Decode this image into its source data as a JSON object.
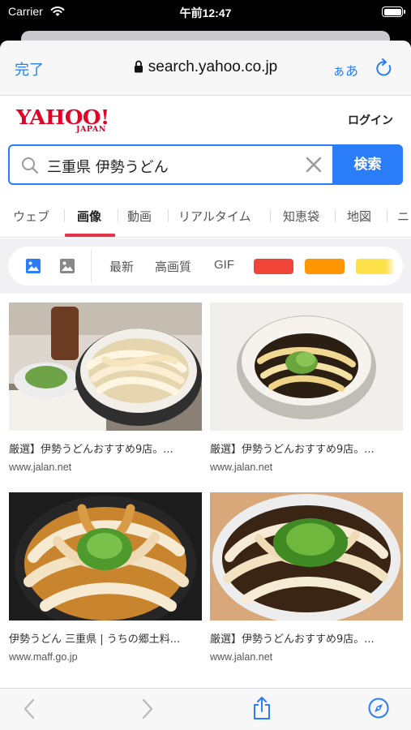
{
  "status_bar": {
    "carrier": "Carrier",
    "time": "午前12:47"
  },
  "nav": {
    "done": "完了",
    "address": "search.yahoo.co.jp",
    "reader": "ぁあ"
  },
  "yahoo": {
    "logo_word": "YAHOO!",
    "logo_sub": "JAPAN",
    "login": "ログイン"
  },
  "search": {
    "query": "三重県 伊勢うどん",
    "button": "検索"
  },
  "tabs": [
    "ウェブ",
    "画像",
    "動画",
    "リアルタイム",
    "知恵袋",
    "地図",
    "ニ"
  ],
  "active_tab": "画像",
  "filters": {
    "new": "最新",
    "hq": "高画質",
    "gif": "GIF",
    "colors": [
      "#f04438",
      "#ff9500",
      "#ffe14a"
    ]
  },
  "results": [
    {
      "title": "厳選】伊勢うどんおすすめ9店。...",
      "source": "www.jalan.net"
    },
    {
      "title": "厳選】伊勢うどんおすすめ9店。...",
      "source": "www.jalan.net"
    },
    {
      "title": "伊勢うどん 三重県 | うちの郷土料...",
      "source": "www.maff.go.jp"
    },
    {
      "title": "厳選】伊勢うどんおすすめ9店。...",
      "source": "www.jalan.net"
    }
  ]
}
